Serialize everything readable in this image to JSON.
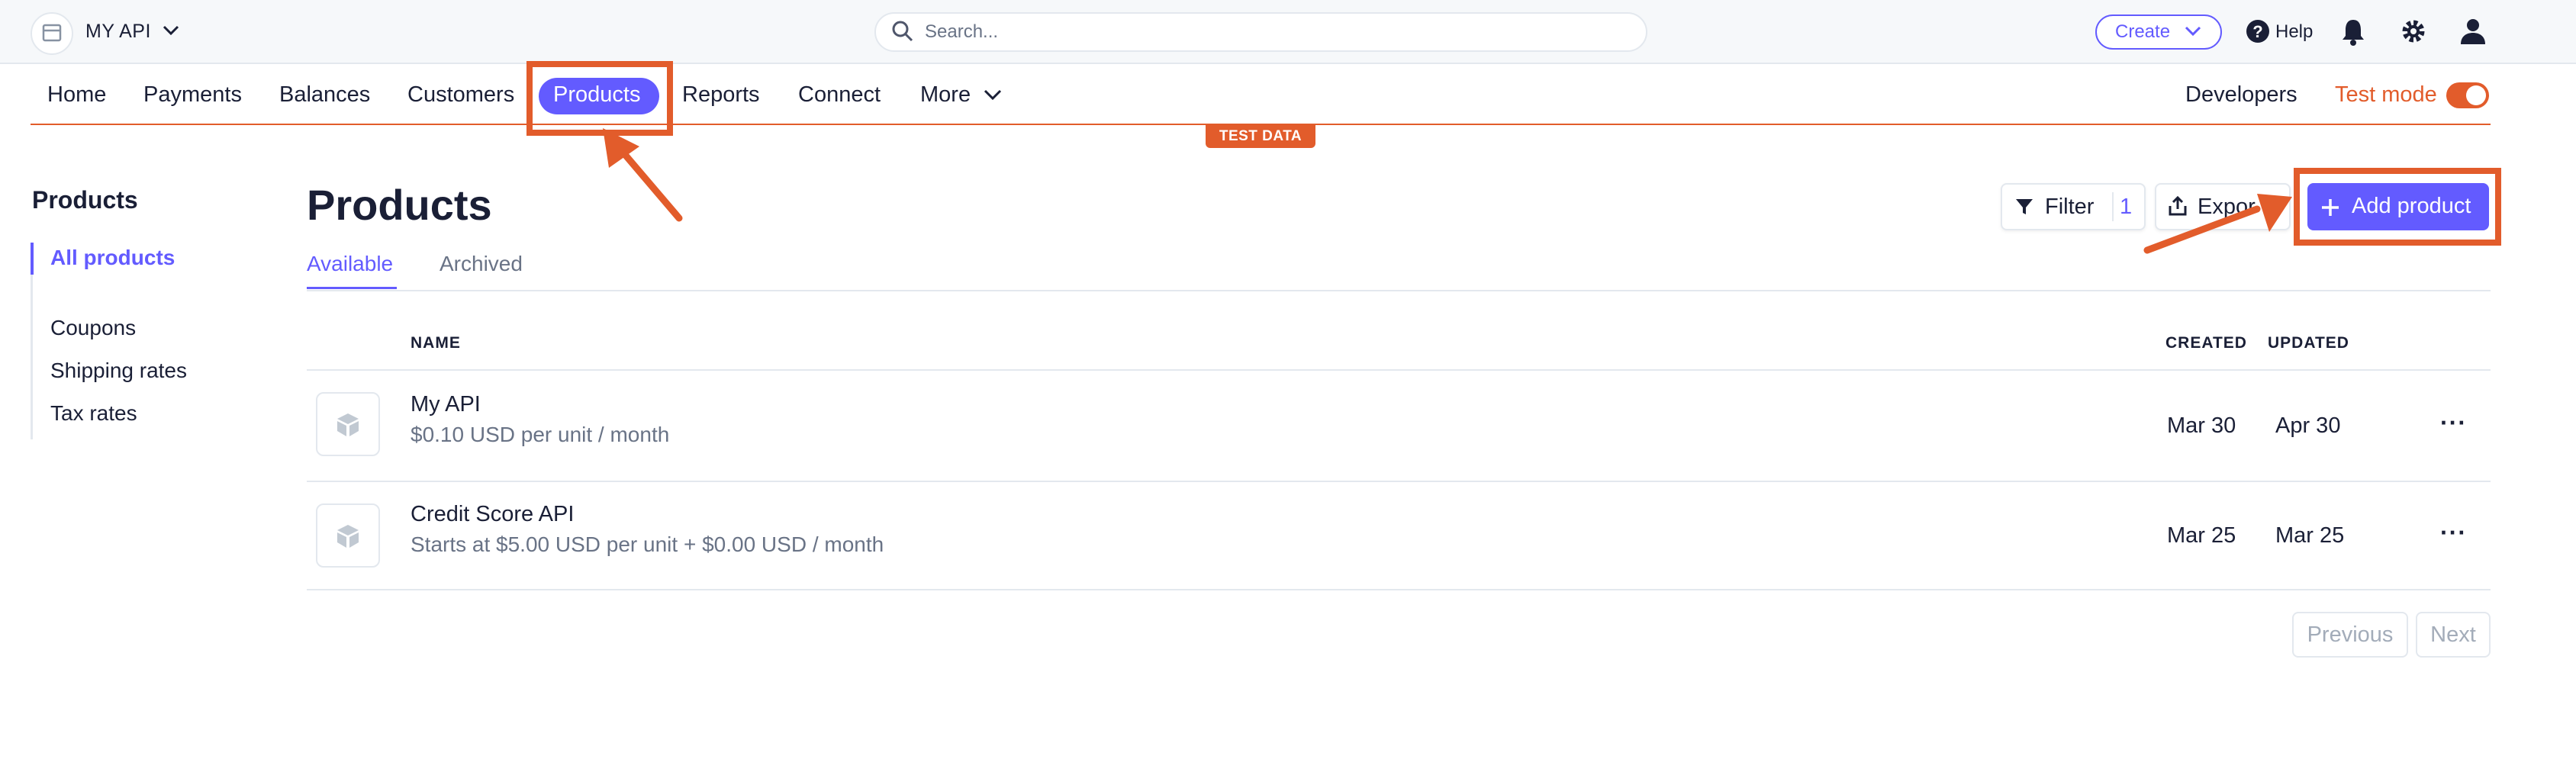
{
  "account": {
    "name": "MY API"
  },
  "search": {
    "placeholder": "Search..."
  },
  "header": {
    "create_label": "Create",
    "help_label": "Help"
  },
  "nav": {
    "items": [
      "Home",
      "Payments",
      "Balances",
      "Customers",
      "Products",
      "Reports",
      "Connect",
      "More"
    ],
    "developers_label": "Developers",
    "test_mode_label": "Test mode",
    "test_mode_on": true,
    "test_data_badge": "TEST DATA"
  },
  "sidebar": {
    "title": "Products",
    "items": [
      "All products",
      "Coupons",
      "Shipping rates",
      "Tax rates"
    ]
  },
  "main": {
    "title": "Products",
    "tabs": [
      "Available",
      "Archived"
    ],
    "filter_label": "Filter",
    "filter_count": "1",
    "export_label": "Expor",
    "add_label": "Add product",
    "columns": {
      "name": "NAME",
      "created": "CREATED",
      "updated": "UPDATED"
    },
    "rows": [
      {
        "name": "My API",
        "desc": "$0.10 USD per unit / month",
        "created": "Mar 30",
        "updated": "Apr 30",
        "more": "···"
      },
      {
        "name": "Credit Score API",
        "desc": "Starts at $5.00 USD per unit + $0.00 USD / month",
        "created": "Mar 25",
        "updated": "Mar 25",
        "more": "···"
      }
    ],
    "pagination": {
      "previous": "Previous",
      "next": "Next"
    }
  },
  "colors": {
    "accent": "#635bff",
    "test_mode": "#e25c2b",
    "annotation": "#e25c2b"
  }
}
